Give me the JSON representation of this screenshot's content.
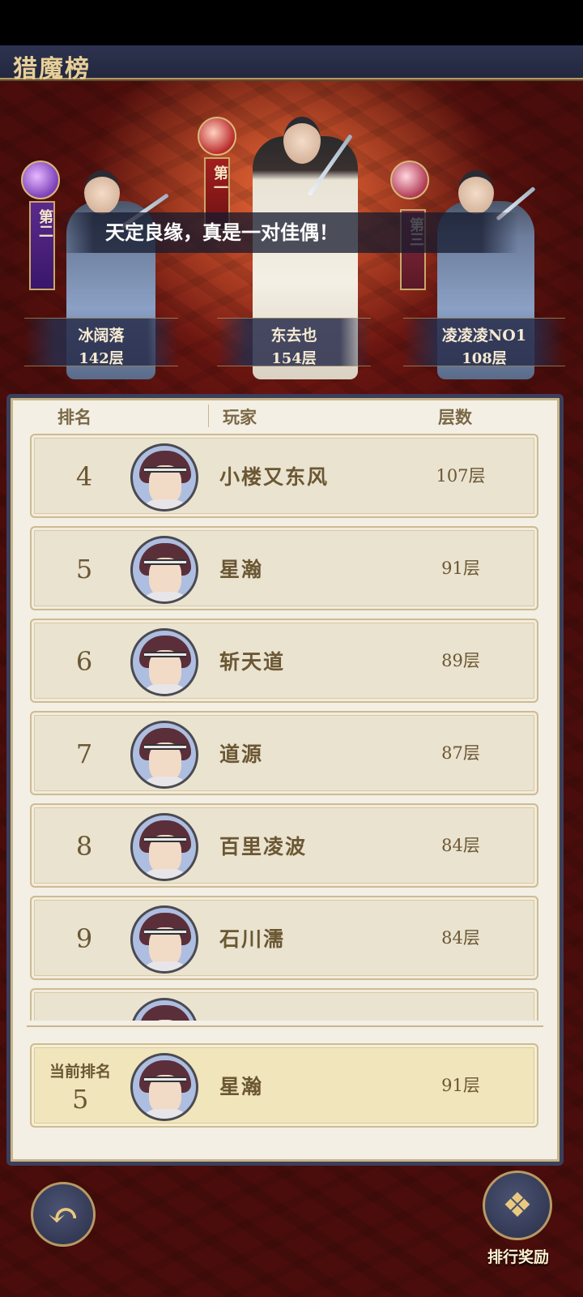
{
  "title": "猎魔榜",
  "marquee": "天定良缘，真是一对佳偶！",
  "podium": [
    {
      "banner": "第二",
      "name": "冰阔落",
      "floors": "142层"
    },
    {
      "banner": "第一",
      "name": "东去也",
      "floors": "154层"
    },
    {
      "banner": "第三",
      "name": "凌凌凌NO1",
      "floors": "108层"
    }
  ],
  "headers": {
    "rank": "排名",
    "player": "玩家",
    "floors": "层数"
  },
  "rows": [
    {
      "rank": "4",
      "name": "小楼又东风",
      "floors": "107层"
    },
    {
      "rank": "5",
      "name": "星瀚",
      "floors": "91层"
    },
    {
      "rank": "6",
      "name": "斩天道",
      "floors": "89层"
    },
    {
      "rank": "7",
      "name": "道源",
      "floors": "87层"
    },
    {
      "rank": "8",
      "name": "百里凌波",
      "floors": "84层"
    },
    {
      "rank": "9",
      "name": "石川濡",
      "floors": "84层"
    }
  ],
  "current": {
    "label": "当前排名",
    "rank": "5",
    "name": "星瀚",
    "floors": "91层"
  },
  "buttons": {
    "reward": "排行奖励",
    "back_icon": "back-arrow-icon",
    "reward_icon": "treasure-chest-icon"
  }
}
